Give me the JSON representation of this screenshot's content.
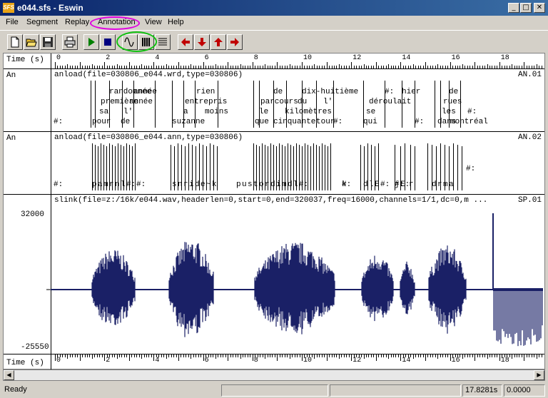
{
  "window": {
    "title": "e044.sfs - Eswin",
    "app_icon_text": "SFS",
    "minimize_glyph": "_",
    "maximize_glyph": "□",
    "close_glyph": "✕"
  },
  "menu": [
    "File",
    "Segment",
    "Replay",
    "Annotation",
    "View",
    "Help"
  ],
  "toolbar": [
    "new-file",
    "open-file",
    "save",
    "print",
    "play",
    "stop",
    "waveform-view",
    "spectrogram-view",
    "text-view",
    "scroll-left",
    "scroll-down",
    "scroll-up",
    "scroll-right"
  ],
  "time_axis": {
    "label": "Time (s)",
    "ticks": [
      "0",
      "2",
      "4",
      "6",
      "8",
      "10",
      "12",
      "14",
      "16",
      "18"
    ]
  },
  "tracks": [
    {
      "label": "An",
      "command": "anload(file=030806_e044.wrd,type=030806)",
      "code": "AN.01",
      "words": [
        "randomnée",
        "année",
        "rien",
        "de",
        "dix-huitième",
        "#:",
        "hier",
        "de",
        "première",
        "année",
        "entrepris",
        "parcours",
        "du",
        "l'",
        "déroulait",
        "rues",
        "sa",
        "l'",
        "a",
        "moins",
        "le",
        "kilomètres",
        "se",
        "les",
        "#:",
        "#:",
        "pour",
        "de",
        "suzanne",
        "que",
        "cinquante",
        "tour",
        "#:",
        "qui",
        "#:",
        "dans",
        "montréal"
      ]
    },
    {
      "label": "An",
      "command": "anload(file=030806_e044.ann,type=030806)",
      "code": "AN.02",
      "phones": [
        "#:",
        "#:",
        "#:",
        "#:",
        "#:",
        "p",
        "a",
        "m",
        "r",
        "n",
        "l",
        "#:",
        "s",
        "n",
        "r",
        "i",
        "d",
        "e",
        "~",
        "k",
        "p",
        "u",
        "s",
        "t",
        "o",
        "r",
        "d",
        "i",
        "m",
        "d",
        "l",
        "#:",
        "k",
        "d",
        "l",
        "E",
        "#:",
        "j",
        "E:",
        "r",
        "d",
        "r",
        "m",
        "a"
      ]
    },
    {
      "label": "",
      "command": "slink(file=z:/16k/e044.wav,headerlen=0,start=0,end=320037,freq=16000,channels=1/1,dc=0,m ...",
      "code": "SP.01",
      "y_max": "32000",
      "y_min": "-25550"
    }
  ],
  "statusbar": {
    "text": "Ready",
    "position": "17.8281s",
    "selection": "0.0000"
  }
}
